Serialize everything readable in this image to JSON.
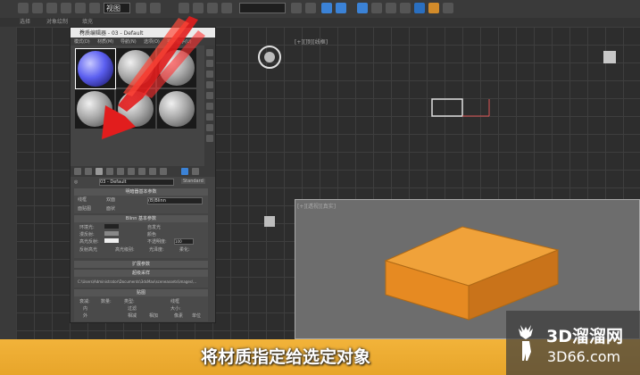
{
  "toolbar": {
    "view_dropdown": "视图",
    "selection_set": ""
  },
  "menubar": {
    "items": [
      "选择",
      "对象绘制",
      "填充"
    ]
  },
  "viewports": {
    "top_label": "[+][顶][线框]",
    "persp_label": "[+][透视][真实]"
  },
  "material_editor": {
    "title": "材质编辑器 - 03 - Default",
    "close": "✕",
    "menu": [
      "模式(D)",
      "材质(M)",
      "导航(N)",
      "选项(O)",
      "实用程序(U)"
    ],
    "name_label": "03 - Default",
    "type_button": "Standard",
    "rollouts": {
      "shader": "明暗器基本参数",
      "blinn": "Blinn 基本参数",
      "extended": "扩展参数",
      "supersampling": "超级采样",
      "maps": "贴图"
    },
    "shader_type": "(B)Blinn",
    "checks": [
      "线框",
      "双面",
      "面贴图",
      "面状"
    ],
    "params": {
      "ambient": "环境光:",
      "diffuse": "漫反射:",
      "specular": "高光反射:",
      "self_illum": "自发光",
      "color": "颜色",
      "opacity": "不透明度:",
      "opacity_value": "100",
      "highlights": "反射高光",
      "specular_level": "高光级别:",
      "glossiness": "光泽度:",
      "soften": "柔化:"
    },
    "advanced": {
      "falloff": "衰减:",
      "inside": "内",
      "outside": "外",
      "amount": "数量:",
      "type": "类型:",
      "filter": "过滤",
      "subtractive": "相减",
      "additive": "相加",
      "wire": "线框",
      "size": "大小:",
      "pixels": "像素",
      "units": "单位"
    },
    "map_path": "C:\\Users\\Administrator\\Documents\\3dsMax\\sceneassets\\images\\..."
  },
  "caption": "将材质指定给选定对象",
  "watermark": {
    "main": "3D溜溜网",
    "sub": "3D66.com"
  },
  "colors": {
    "banner": "#f0ad36",
    "box": "#e8952f",
    "arrow": "#e21d1d",
    "selected_sphere": "#5b5ff0"
  }
}
